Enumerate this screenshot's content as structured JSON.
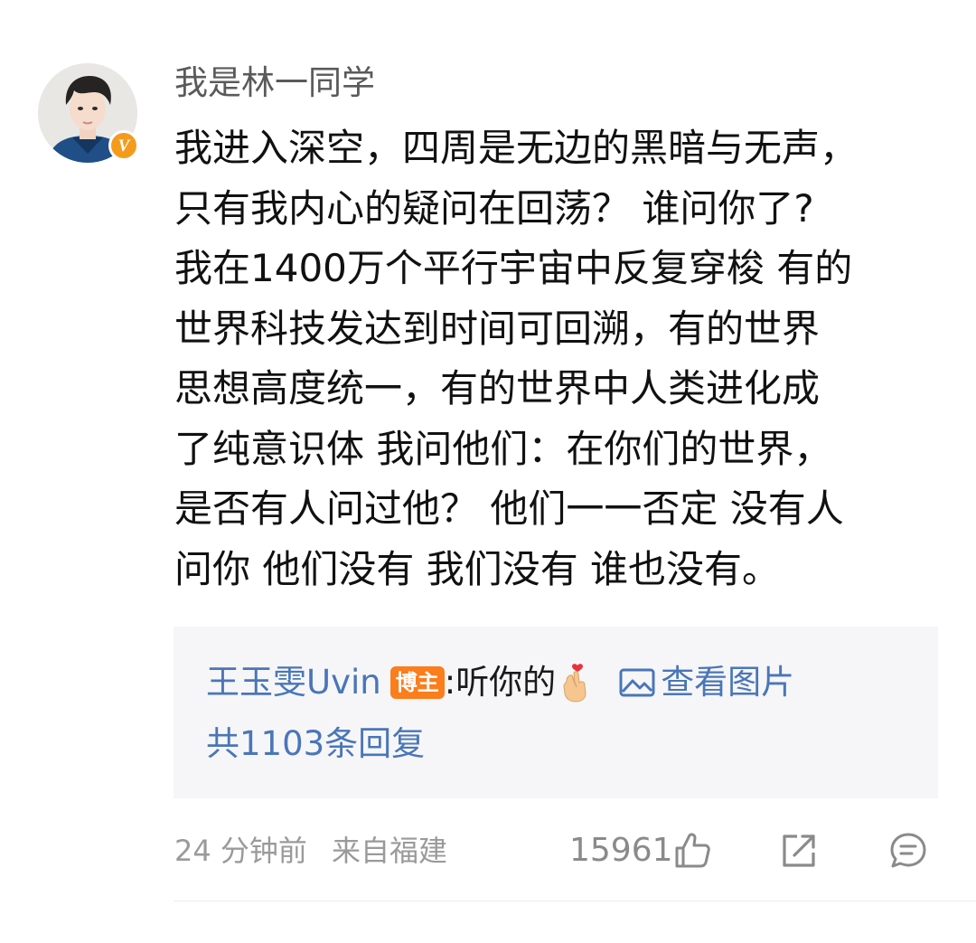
{
  "comment": {
    "username": "我是林一同学",
    "verified_badge": "V",
    "body_lines": [
      "我进入深空，四周是无边的黑暗与无声，",
      "只有我内心的疑问在回荡？ 谁问你了?",
      "我在1400万个平行宇宙中反复穿梭 有的",
      "世界科技发达到时间可回溯，有的世界",
      "思想高度统一，有的世界中人类进化成",
      "了纯意识体 我问他们：在你们的世界，",
      "是否有人问过他？ 他们一一否定 没有人",
      "问你 他们没有 我们没有 谁也没有。"
    ]
  },
  "reply": {
    "author": "王玉雯Uvin",
    "author_tag": "博主",
    "colon": ":",
    "text": " 听你的",
    "emoji_icon": "finger-heart-hand-icon",
    "view_images_label": "查看图片",
    "view_images_icon": "image-icon",
    "total_replies": "共1103条回复"
  },
  "footer": {
    "time": "24 分钟前",
    "location": "来自福建",
    "like_count": "15961",
    "icons": [
      "thumbs-up-icon",
      "share-icon",
      "comment-icon"
    ]
  },
  "colors": {
    "link_blue": "#4a76b8",
    "tag_orange": "#fb7d1c",
    "badge_orange": "#f59b1b",
    "meta_gray": "#9a9a9a",
    "reply_bg": "#f6f6f8"
  }
}
